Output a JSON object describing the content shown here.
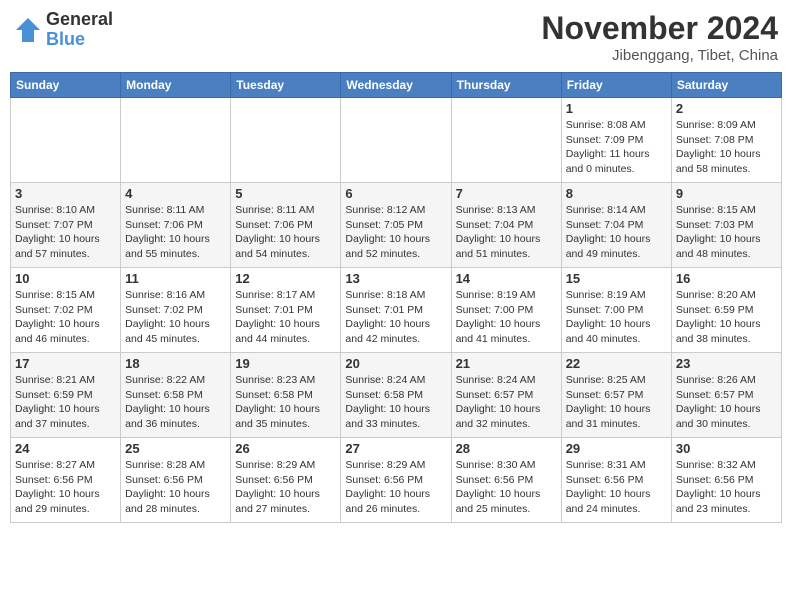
{
  "header": {
    "logo_general": "General",
    "logo_blue": "Blue",
    "month_title": "November 2024",
    "location": "Jibenggang, Tibet, China"
  },
  "weekdays": [
    "Sunday",
    "Monday",
    "Tuesday",
    "Wednesday",
    "Thursday",
    "Friday",
    "Saturday"
  ],
  "weeks": [
    [
      {
        "day": "",
        "detail": ""
      },
      {
        "day": "",
        "detail": ""
      },
      {
        "day": "",
        "detail": ""
      },
      {
        "day": "",
        "detail": ""
      },
      {
        "day": "",
        "detail": ""
      },
      {
        "day": "1",
        "detail": "Sunrise: 8:08 AM\nSunset: 7:09 PM\nDaylight: 11 hours\nand 0 minutes."
      },
      {
        "day": "2",
        "detail": "Sunrise: 8:09 AM\nSunset: 7:08 PM\nDaylight: 10 hours\nand 58 minutes."
      }
    ],
    [
      {
        "day": "3",
        "detail": "Sunrise: 8:10 AM\nSunset: 7:07 PM\nDaylight: 10 hours\nand 57 minutes."
      },
      {
        "day": "4",
        "detail": "Sunrise: 8:11 AM\nSunset: 7:06 PM\nDaylight: 10 hours\nand 55 minutes."
      },
      {
        "day": "5",
        "detail": "Sunrise: 8:11 AM\nSunset: 7:06 PM\nDaylight: 10 hours\nand 54 minutes."
      },
      {
        "day": "6",
        "detail": "Sunrise: 8:12 AM\nSunset: 7:05 PM\nDaylight: 10 hours\nand 52 minutes."
      },
      {
        "day": "7",
        "detail": "Sunrise: 8:13 AM\nSunset: 7:04 PM\nDaylight: 10 hours\nand 51 minutes."
      },
      {
        "day": "8",
        "detail": "Sunrise: 8:14 AM\nSunset: 7:04 PM\nDaylight: 10 hours\nand 49 minutes."
      },
      {
        "day": "9",
        "detail": "Sunrise: 8:15 AM\nSunset: 7:03 PM\nDaylight: 10 hours\nand 48 minutes."
      }
    ],
    [
      {
        "day": "10",
        "detail": "Sunrise: 8:15 AM\nSunset: 7:02 PM\nDaylight: 10 hours\nand 46 minutes."
      },
      {
        "day": "11",
        "detail": "Sunrise: 8:16 AM\nSunset: 7:02 PM\nDaylight: 10 hours\nand 45 minutes."
      },
      {
        "day": "12",
        "detail": "Sunrise: 8:17 AM\nSunset: 7:01 PM\nDaylight: 10 hours\nand 44 minutes."
      },
      {
        "day": "13",
        "detail": "Sunrise: 8:18 AM\nSunset: 7:01 PM\nDaylight: 10 hours\nand 42 minutes."
      },
      {
        "day": "14",
        "detail": "Sunrise: 8:19 AM\nSunset: 7:00 PM\nDaylight: 10 hours\nand 41 minutes."
      },
      {
        "day": "15",
        "detail": "Sunrise: 8:19 AM\nSunset: 7:00 PM\nDaylight: 10 hours\nand 40 minutes."
      },
      {
        "day": "16",
        "detail": "Sunrise: 8:20 AM\nSunset: 6:59 PM\nDaylight: 10 hours\nand 38 minutes."
      }
    ],
    [
      {
        "day": "17",
        "detail": "Sunrise: 8:21 AM\nSunset: 6:59 PM\nDaylight: 10 hours\nand 37 minutes."
      },
      {
        "day": "18",
        "detail": "Sunrise: 8:22 AM\nSunset: 6:58 PM\nDaylight: 10 hours\nand 36 minutes."
      },
      {
        "day": "19",
        "detail": "Sunrise: 8:23 AM\nSunset: 6:58 PM\nDaylight: 10 hours\nand 35 minutes."
      },
      {
        "day": "20",
        "detail": "Sunrise: 8:24 AM\nSunset: 6:58 PM\nDaylight: 10 hours\nand 33 minutes."
      },
      {
        "day": "21",
        "detail": "Sunrise: 8:24 AM\nSunset: 6:57 PM\nDaylight: 10 hours\nand 32 minutes."
      },
      {
        "day": "22",
        "detail": "Sunrise: 8:25 AM\nSunset: 6:57 PM\nDaylight: 10 hours\nand 31 minutes."
      },
      {
        "day": "23",
        "detail": "Sunrise: 8:26 AM\nSunset: 6:57 PM\nDaylight: 10 hours\nand 30 minutes."
      }
    ],
    [
      {
        "day": "24",
        "detail": "Sunrise: 8:27 AM\nSunset: 6:56 PM\nDaylight: 10 hours\nand 29 minutes."
      },
      {
        "day": "25",
        "detail": "Sunrise: 8:28 AM\nSunset: 6:56 PM\nDaylight: 10 hours\nand 28 minutes."
      },
      {
        "day": "26",
        "detail": "Sunrise: 8:29 AM\nSunset: 6:56 PM\nDaylight: 10 hours\nand 27 minutes."
      },
      {
        "day": "27",
        "detail": "Sunrise: 8:29 AM\nSunset: 6:56 PM\nDaylight: 10 hours\nand 26 minutes."
      },
      {
        "day": "28",
        "detail": "Sunrise: 8:30 AM\nSunset: 6:56 PM\nDaylight: 10 hours\nand 25 minutes."
      },
      {
        "day": "29",
        "detail": "Sunrise: 8:31 AM\nSunset: 6:56 PM\nDaylight: 10 hours\nand 24 minutes."
      },
      {
        "day": "30",
        "detail": "Sunrise: 8:32 AM\nSunset: 6:56 PM\nDaylight: 10 hours\nand 23 minutes."
      }
    ]
  ]
}
